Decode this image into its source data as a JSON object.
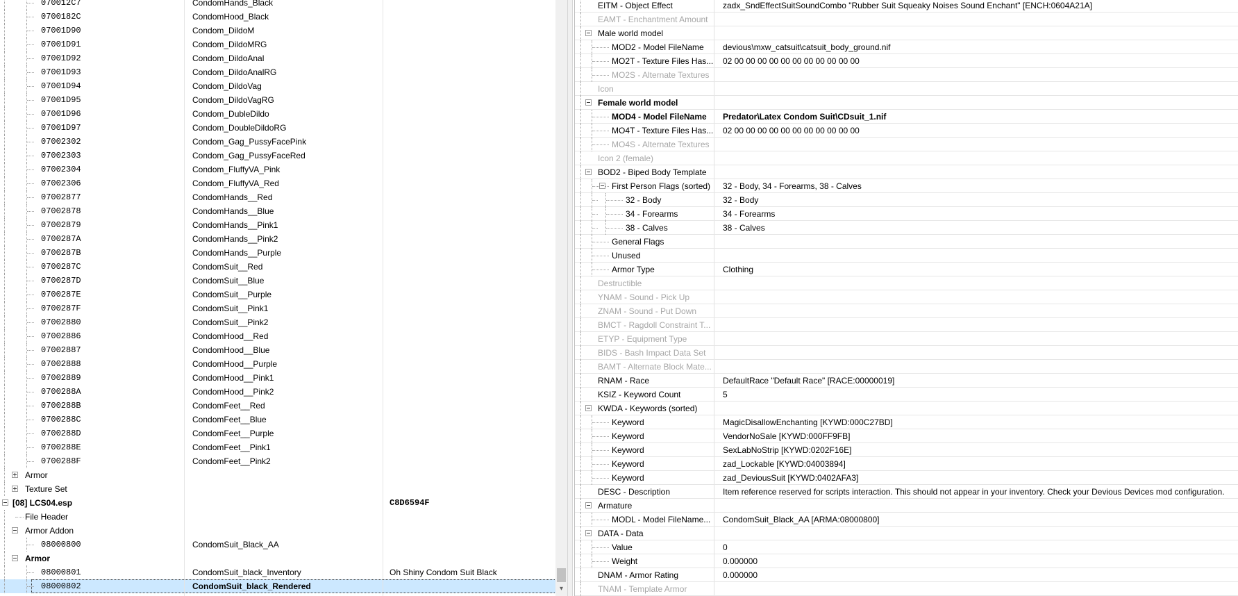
{
  "left_tree": {
    "rows": [
      {
        "indent": 2,
        "formid": "070012C7",
        "editor_id": "CondomHands_Black",
        "name": ""
      },
      {
        "indent": 2,
        "formid": "0700182C",
        "editor_id": "CondomHood_Black",
        "name": ""
      },
      {
        "indent": 2,
        "formid": "07001D90",
        "editor_id": "Condom_DildoM",
        "name": ""
      },
      {
        "indent": 2,
        "formid": "07001D91",
        "editor_id": "Condom_DildoMRG",
        "name": ""
      },
      {
        "indent": 2,
        "formid": "07001D92",
        "editor_id": "Condom_DildoAnal",
        "name": ""
      },
      {
        "indent": 2,
        "formid": "07001D93",
        "editor_id": "Condom_DildoAnalRG",
        "name": ""
      },
      {
        "indent": 2,
        "formid": "07001D94",
        "editor_id": "Condom_DildoVag",
        "name": ""
      },
      {
        "indent": 2,
        "formid": "07001D95",
        "editor_id": "Condom_DildoVagRG",
        "name": ""
      },
      {
        "indent": 2,
        "formid": "07001D96",
        "editor_id": "Condom_DubleDildo",
        "name": ""
      },
      {
        "indent": 2,
        "formid": "07001D97",
        "editor_id": "Condom_DoubleDildoRG",
        "name": ""
      },
      {
        "indent": 2,
        "formid": "07002302",
        "editor_id": "Condom_Gag_PussyFacePink",
        "name": ""
      },
      {
        "indent": 2,
        "formid": "07002303",
        "editor_id": "Condom_Gag_PussyFaceRed",
        "name": ""
      },
      {
        "indent": 2,
        "formid": "07002304",
        "editor_id": "Condom_FluffyVA_Pink",
        "name": ""
      },
      {
        "indent": 2,
        "formid": "07002306",
        "editor_id": "Condom_FluffyVA_Red",
        "name": ""
      },
      {
        "indent": 2,
        "formid": "07002877",
        "editor_id": "CondomHands__Red",
        "name": ""
      },
      {
        "indent": 2,
        "formid": "07002878",
        "editor_id": "CondomHands__Blue",
        "name": ""
      },
      {
        "indent": 2,
        "formid": "07002879",
        "editor_id": "CondomHands__Pink1",
        "name": ""
      },
      {
        "indent": 2,
        "formid": "0700287A",
        "editor_id": "CondomHands__Pink2",
        "name": ""
      },
      {
        "indent": 2,
        "formid": "0700287B",
        "editor_id": "CondomHands__Purple",
        "name": ""
      },
      {
        "indent": 2,
        "formid": "0700287C",
        "editor_id": "CondomSuit__Red",
        "name": ""
      },
      {
        "indent": 2,
        "formid": "0700287D",
        "editor_id": "CondomSuit__Blue",
        "name": ""
      },
      {
        "indent": 2,
        "formid": "0700287E",
        "editor_id": "CondomSuit__Purple",
        "name": ""
      },
      {
        "indent": 2,
        "formid": "0700287F",
        "editor_id": "CondomSuit__Pink1",
        "name": ""
      },
      {
        "indent": 2,
        "formid": "07002880",
        "editor_id": "CondomSuit__Pink2",
        "name": ""
      },
      {
        "indent": 2,
        "formid": "07002886",
        "editor_id": "CondomHood__Red",
        "name": ""
      },
      {
        "indent": 2,
        "formid": "07002887",
        "editor_id": "CondomHood__Blue",
        "name": ""
      },
      {
        "indent": 2,
        "formid": "07002888",
        "editor_id": "CondomHood__Purple",
        "name": ""
      },
      {
        "indent": 2,
        "formid": "07002889",
        "editor_id": "CondomHood__Pink1",
        "name": ""
      },
      {
        "indent": 2,
        "formid": "0700288A",
        "editor_id": "CondomHood__Pink2",
        "name": ""
      },
      {
        "indent": 2,
        "formid": "0700288B",
        "editor_id": "CondomFeet__Red",
        "name": ""
      },
      {
        "indent": 2,
        "formid": "0700288C",
        "editor_id": "CondomFeet__Blue",
        "name": ""
      },
      {
        "indent": 2,
        "formid": "0700288D",
        "editor_id": "CondomFeet__Purple",
        "name": ""
      },
      {
        "indent": 2,
        "formid": "0700288E",
        "editor_id": "CondomFeet__Pink1",
        "name": ""
      },
      {
        "indent": 2,
        "formid": "0700288F",
        "editor_id": "CondomFeet__Pink2",
        "name": ""
      },
      {
        "indent": 1,
        "group": "Armor",
        "expander": "plus"
      },
      {
        "indent": 1,
        "group": "Texture Set",
        "expander": "plus"
      },
      {
        "indent": 0,
        "group": "[08] LCS04.esp",
        "bold": true,
        "expander": "minus",
        "crc": "C8D6594F"
      },
      {
        "indent": 1,
        "group": "File Header"
      },
      {
        "indent": 1,
        "group": "Armor Addon",
        "expander": "minus"
      },
      {
        "indent": 2,
        "formid": "08000800",
        "editor_id": "CondomSuit_Black_AA",
        "name": ""
      },
      {
        "indent": 1,
        "group": "Armor",
        "bold": true,
        "expander": "minus"
      },
      {
        "indent": 2,
        "formid": "08000801",
        "editor_id": "CondomSuit_black_Inventory",
        "name": "Oh Shiny Condom Suit Black"
      },
      {
        "indent": 2,
        "formid": "08000802",
        "editor_id": "CondomSuit_black_Rendered",
        "name": "",
        "selected": true
      }
    ]
  },
  "scrollbar": {
    "down_arrow": "▾"
  },
  "record_view": {
    "rows": [
      {
        "level": 0,
        "name": "EITM - Object Effect",
        "value": "zadx_SndEffectSuitSoundCombo \"Rubber Suit Squeaky Noises Sound Enchant\" [ENCH:0604A21A]"
      },
      {
        "level": 0,
        "name": "EAMT - Enchantment Amount",
        "value": "",
        "disabled": true
      },
      {
        "level": 0,
        "name": "Male world model",
        "value": "",
        "expander": "minus"
      },
      {
        "level": 1,
        "name": "MOD2 - Model FileName",
        "value": "devious\\mxw_catsuit\\catsuit_body_ground.nif"
      },
      {
        "level": 1,
        "name": "MO2T - Texture Files Has...",
        "value": "02 00 00 00 00 00 00 00 00 00 00 00"
      },
      {
        "level": 1,
        "name": "MO2S - Alternate Textures",
        "value": "",
        "disabled": true
      },
      {
        "level": 0,
        "name": "Icon",
        "value": "",
        "disabled": true
      },
      {
        "level": 0,
        "name": "Female world model",
        "value": "",
        "expander": "minus",
        "bold": true
      },
      {
        "level": 1,
        "name": "MOD4 - Model FileName",
        "value": "Predator\\Latex Condom Suit\\CDsuit_1.nif",
        "bold": true
      },
      {
        "level": 1,
        "name": "MO4T - Texture Files Has...",
        "value": "02 00 00 00 00 00 00 00 00 00 00 00"
      },
      {
        "level": 1,
        "name": "MO4S - Alternate Textures",
        "value": "",
        "disabled": true
      },
      {
        "level": 0,
        "name": "Icon 2 (female)",
        "value": "",
        "disabled": true
      },
      {
        "level": 0,
        "name": "BOD2 - Biped Body Template",
        "value": "",
        "expander": "minus"
      },
      {
        "level": 1,
        "name": "First Person Flags (sorted)",
        "value": "32 - Body, 34 - Forearms, 38 - Calves",
        "expander": "minus"
      },
      {
        "level": 2,
        "name": "32 - Body",
        "value": "32 - Body"
      },
      {
        "level": 2,
        "name": "34 - Forearms",
        "value": "34 - Forearms"
      },
      {
        "level": 2,
        "name": "38 - Calves",
        "value": "38 - Calves"
      },
      {
        "level": 1,
        "name": "General Flags",
        "value": ""
      },
      {
        "level": 1,
        "name": "Unused",
        "value": ""
      },
      {
        "level": 1,
        "name": "Armor Type",
        "value": "Clothing"
      },
      {
        "level": 0,
        "name": "Destructible",
        "value": "",
        "disabled": true
      },
      {
        "level": 0,
        "name": "YNAM - Sound - Pick Up",
        "value": "",
        "disabled": true
      },
      {
        "level": 0,
        "name": "ZNAM - Sound - Put Down",
        "value": "",
        "disabled": true
      },
      {
        "level": 0,
        "name": "BMCT - Ragdoll Constraint T...",
        "value": "",
        "disabled": true
      },
      {
        "level": 0,
        "name": "ETYP - Equipment Type",
        "value": "",
        "disabled": true
      },
      {
        "level": 0,
        "name": "BIDS - Bash Impact Data Set",
        "value": "",
        "disabled": true
      },
      {
        "level": 0,
        "name": "BAMT - Alternate Block Mate...",
        "value": "",
        "disabled": true
      },
      {
        "level": 0,
        "name": "RNAM - Race",
        "value": "DefaultRace \"Default Race\" [RACE:00000019]"
      },
      {
        "level": 0,
        "name": "KSIZ - Keyword Count",
        "value": "5"
      },
      {
        "level": 0,
        "name": "KWDA - Keywords (sorted)",
        "value": "",
        "expander": "minus"
      },
      {
        "level": 1,
        "name": "Keyword",
        "value": "MagicDisallowEnchanting [KYWD:000C27BD]"
      },
      {
        "level": 1,
        "name": "Keyword",
        "value": "VendorNoSale [KYWD:000FF9FB]"
      },
      {
        "level": 1,
        "name": "Keyword",
        "value": "SexLabNoStrip [KYWD:0202F16E]"
      },
      {
        "level": 1,
        "name": "Keyword",
        "value": "zad_Lockable [KYWD:04003894]"
      },
      {
        "level": 1,
        "name": "Keyword",
        "value": "zad_DeviousSuit [KYWD:0402AFA3]"
      },
      {
        "level": 0,
        "name": "DESC - Description",
        "value": "Item reference reserved for scripts interaction. This should not appear in your inventory. Check your Devious Devices mod configuration."
      },
      {
        "level": 0,
        "name": "Armature",
        "value": "",
        "expander": "minus"
      },
      {
        "level": 1,
        "name": "MODL - Model FileName...",
        "value": "CondomSuit_Black_AA [ARMA:08000800]"
      },
      {
        "level": 0,
        "name": "DATA - Data",
        "value": "",
        "expander": "minus"
      },
      {
        "level": 1,
        "name": "Value",
        "value": "0"
      },
      {
        "level": 1,
        "name": "Weight",
        "value": "0.000000"
      },
      {
        "level": 0,
        "name": "DNAM - Armor Rating",
        "value": "0.000000"
      },
      {
        "level": 0,
        "name": "TNAM - Template Armor",
        "value": "",
        "disabled": true
      }
    ]
  }
}
